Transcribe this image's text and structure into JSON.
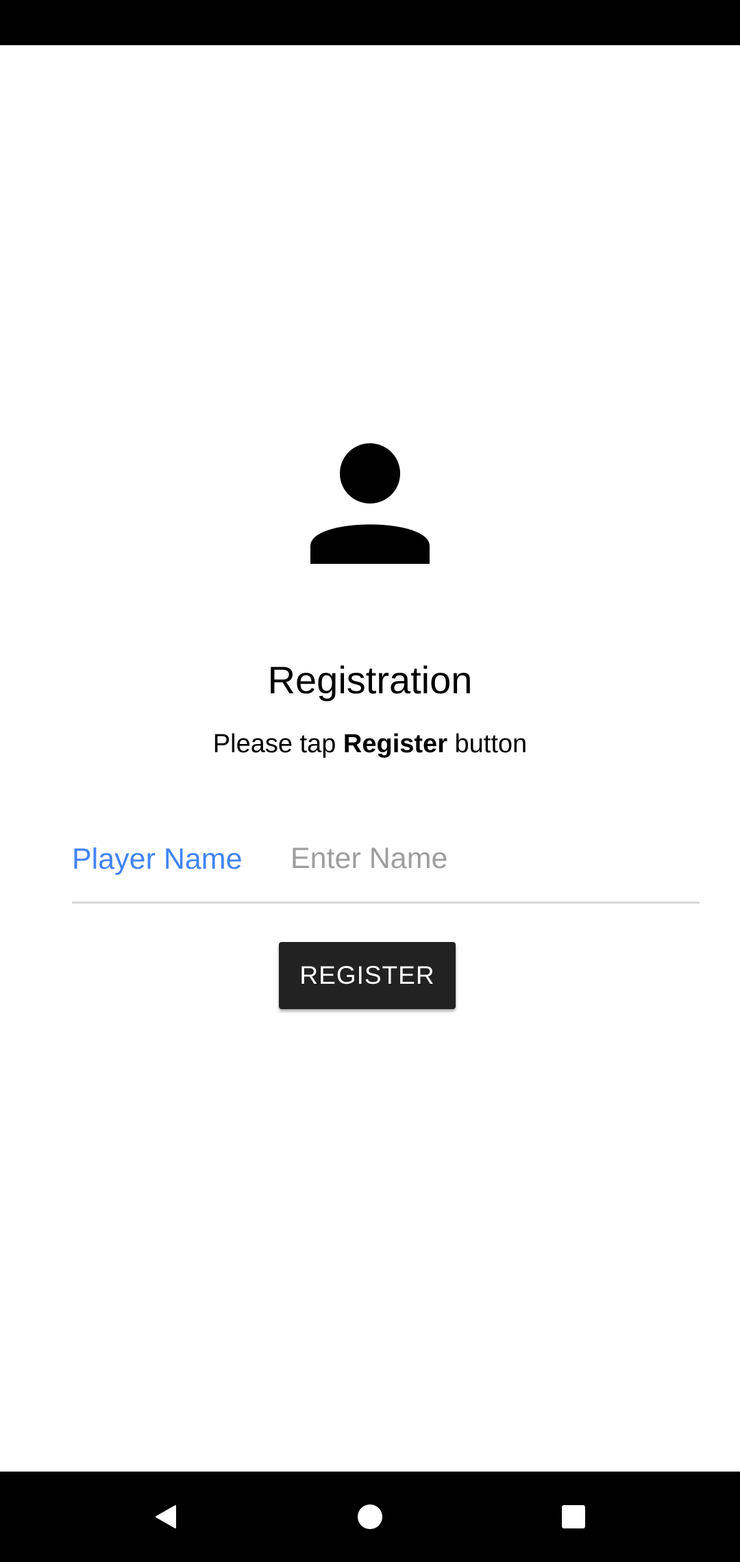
{
  "screen": {
    "title": "Registration",
    "instruction": {
      "prefix": "Please tap ",
      "emphasis": "Register",
      "suffix": " button"
    }
  },
  "form": {
    "player_name_label": "Player Name",
    "player_name_value": "",
    "player_name_placeholder": "Enter Name"
  },
  "actions": {
    "register_label": "REGISTER"
  },
  "icons": {
    "avatar": "person-icon",
    "nav_back": "back-icon",
    "nav_home": "home-icon",
    "nav_recents": "recents-icon"
  },
  "colors": {
    "label_accent": "#4285f4",
    "button_bg": "#222222",
    "button_text": "#ffffff",
    "placeholder": "#9e9e9e",
    "system_bars": "#000000"
  }
}
